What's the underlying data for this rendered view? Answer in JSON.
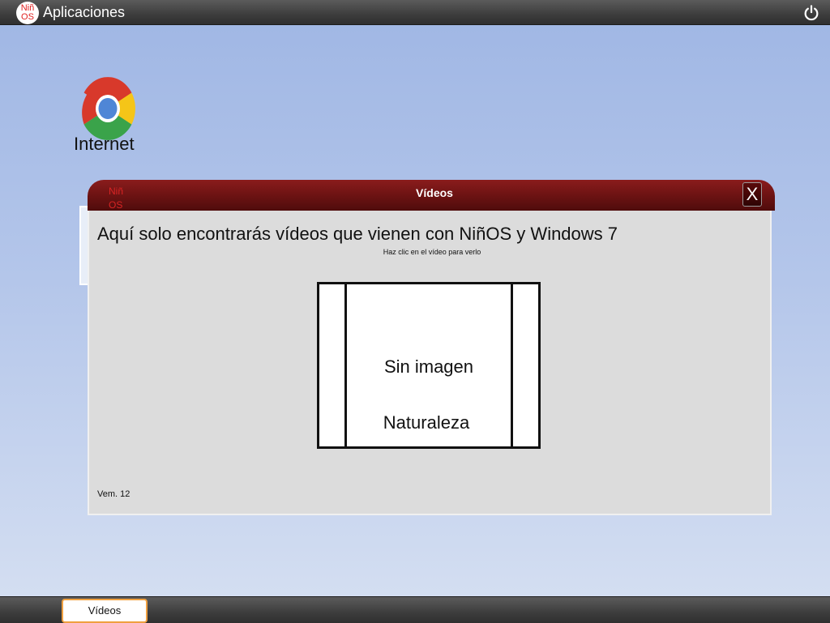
{
  "topbar": {
    "logo_line1": "Niñ",
    "logo_line2": "OS",
    "title": "Aplicaciones",
    "power_icon": "power-icon"
  },
  "desktop": {
    "icons": [
      {
        "label": "Internet",
        "icon": "chrome-icon"
      }
    ]
  },
  "window": {
    "logo_line1": "Niñ",
    "logo_line2": "OS",
    "title": "Vídeos",
    "close_label": "X",
    "heading": "Aquí solo encontrarás vídeos que vienen con NiñOS y Windows 7",
    "hint": "Haz clic en el vídeo para verlo",
    "videos": [
      {
        "thumbnail_text": "Sin imagen",
        "name": "Naturaleza"
      }
    ],
    "version": "Vem. 12"
  },
  "taskbar": {
    "items": [
      {
        "label": "Vídeos",
        "active": true
      }
    ]
  },
  "colors": {
    "titlebar": "#6a1212",
    "active_task_border": "#f0a040",
    "logo_red": "#e02020"
  }
}
